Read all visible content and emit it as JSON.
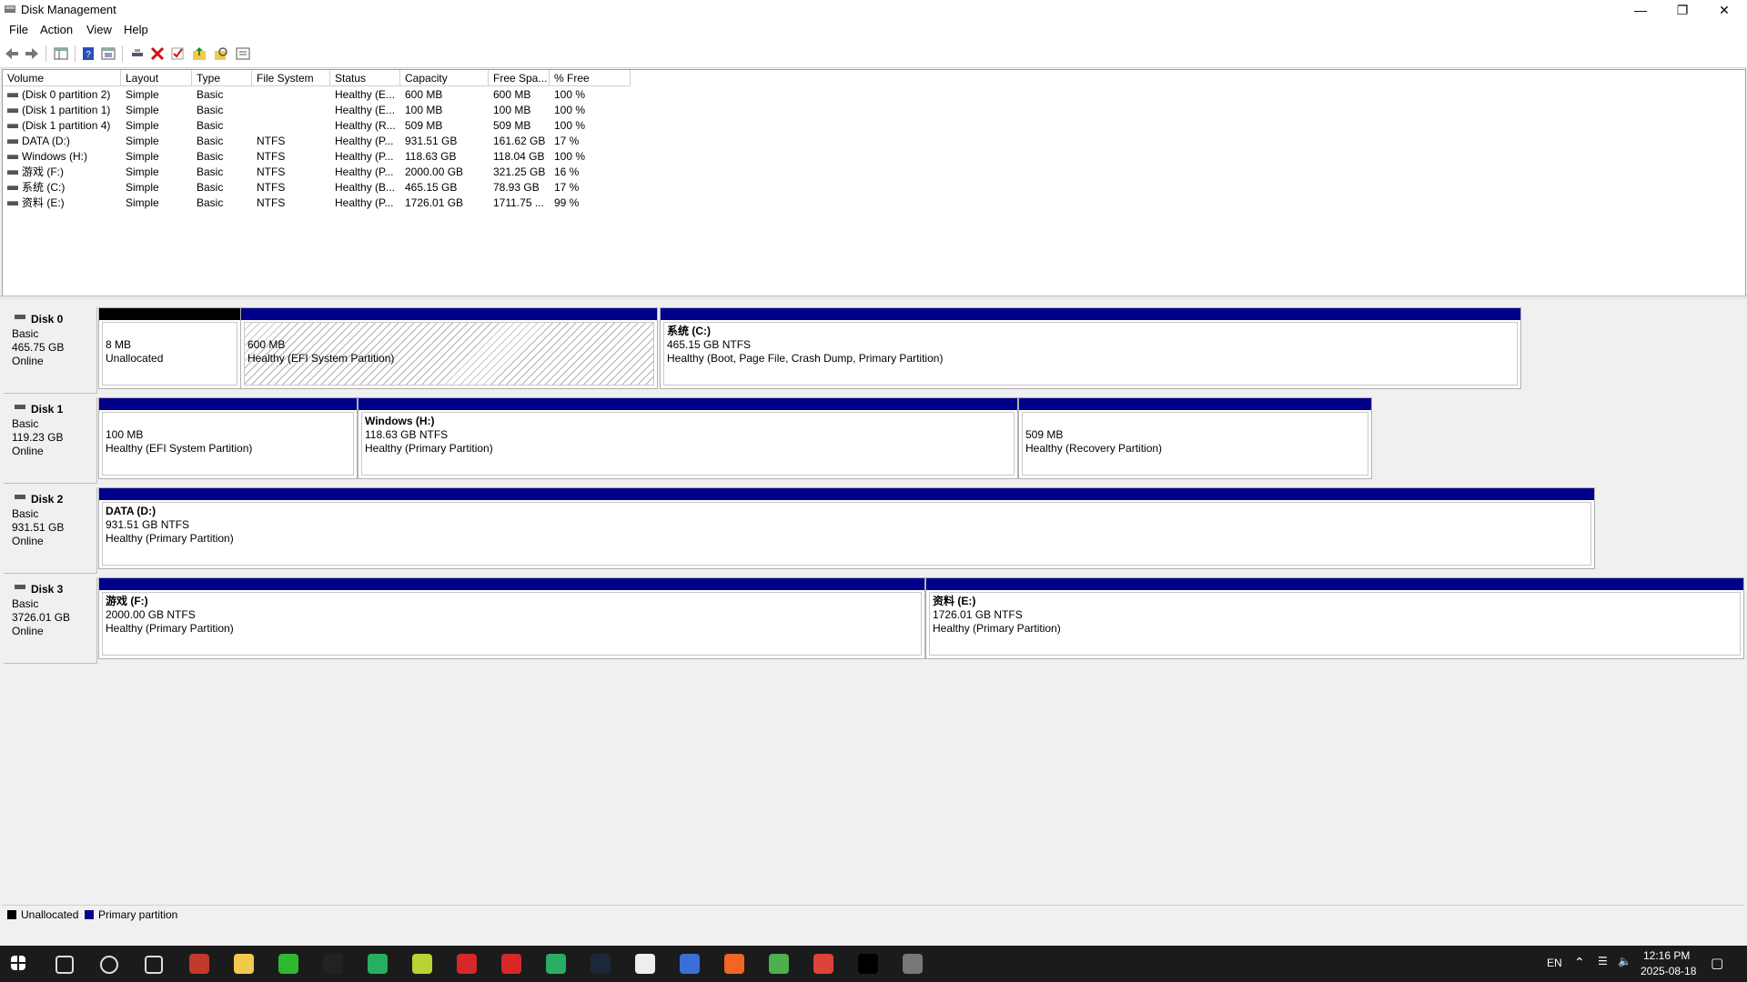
{
  "window": {
    "title": "Disk Management"
  },
  "menu": [
    "File",
    "Action",
    "View",
    "Help"
  ],
  "toolbar": [
    "back-icon",
    "forward-icon",
    "console-tree-icon",
    "help-icon",
    "properties-icon",
    "connect-icon",
    "delete-icon",
    "check-icon",
    "folder-up-icon",
    "search-folder-icon",
    "list-view-icon"
  ],
  "table": {
    "columns": [
      "Volume",
      "Layout",
      "Type",
      "File System",
      "Status",
      "Capacity",
      "Free Spa...",
      "% Free"
    ],
    "rows": [
      [
        "(Disk 0 partition 2)",
        "Simple",
        "Basic",
        "",
        "Healthy (E...",
        "600 MB",
        "600 MB",
        "100 %"
      ],
      [
        "(Disk 1 partition 1)",
        "Simple",
        "Basic",
        "",
        "Healthy (E...",
        "100 MB",
        "100 MB",
        "100 %"
      ],
      [
        "(Disk 1 partition 4)",
        "Simple",
        "Basic",
        "",
        "Healthy (R...",
        "509 MB",
        "509 MB",
        "100 %"
      ],
      [
        "DATA (D:)",
        "Simple",
        "Basic",
        "NTFS",
        "Healthy (P...",
        "931.51 GB",
        "161.62 GB",
        "17 %"
      ],
      [
        "Windows (H:)",
        "Simple",
        "Basic",
        "NTFS",
        "Healthy (P...",
        "118.63 GB",
        "118.04 GB",
        "100 %"
      ],
      [
        "游戏 (F:)",
        "Simple",
        "Basic",
        "NTFS",
        "Healthy (P...",
        "2000.00 GB",
        "321.25 GB",
        "16 %"
      ],
      [
        "系统 (C:)",
        "Simple",
        "Basic",
        "NTFS",
        "Healthy (B...",
        "465.15 GB",
        "78.93 GB",
        "17 %"
      ],
      [
        "资料 (E:)",
        "Simple",
        "Basic",
        "NTFS",
        "Healthy (P...",
        "1726.01 GB",
        "1711.75 ...",
        "99 %"
      ]
    ]
  },
  "disks": [
    {
      "name": "Disk 0",
      "type": "Basic",
      "size": "465.75 GB",
      "status": "Online",
      "partitions": [
        {
          "title": "",
          "line1": "8 MB",
          "line2": "Unallocated",
          "kind": "unallocated"
        },
        {
          "title": "",
          "line1": "600 MB",
          "line2": "Healthy (EFI System Partition)",
          "kind": "hatched"
        },
        {
          "title": "系统  (C:)",
          "line1": "465.15 GB NTFS",
          "line2": "Healthy (Boot, Page File, Crash Dump, Primary Partition)",
          "kind": "primary"
        }
      ]
    },
    {
      "name": "Disk 1",
      "type": "Basic",
      "size": "119.23 GB",
      "status": "Online",
      "partitions": [
        {
          "title": "",
          "line1": "100 MB",
          "line2": "Healthy (EFI System Partition)",
          "kind": "primary"
        },
        {
          "title": "Windows  (H:)",
          "line1": "118.63 GB NTFS",
          "line2": "Healthy (Primary Partition)",
          "kind": "primary"
        },
        {
          "title": "",
          "line1": "509 MB",
          "line2": "Healthy (Recovery Partition)",
          "kind": "primary"
        }
      ]
    },
    {
      "name": "Disk 2",
      "type": "Basic",
      "size": "931.51 GB",
      "status": "Online",
      "partitions": [
        {
          "title": "DATA  (D:)",
          "line1": "931.51 GB NTFS",
          "line2": "Healthy (Primary Partition)",
          "kind": "primary"
        }
      ]
    },
    {
      "name": "Disk 3",
      "type": "Basic",
      "size": "3726.01 GB",
      "status": "Online",
      "partitions": [
        {
          "title": "游戏  (F:)",
          "line1": "2000.00 GB NTFS",
          "line2": "Healthy (Primary Partition)",
          "kind": "primary"
        },
        {
          "title": "资料  (E:)",
          "line1": "1726.01 GB NTFS",
          "line2": "Healthy (Primary Partition)",
          "kind": "primary"
        }
      ]
    }
  ],
  "legend": {
    "unallocated": "Unallocated",
    "primary": "Primary partition"
  },
  "colors": {
    "primary": "#00008b",
    "unallocated": "#000000"
  },
  "taskbar": {
    "apps": [
      "windows-start-icon",
      "search-icon",
      "cortana-icon",
      "task-view-icon",
      "tool-app-icon",
      "file-explorer-icon",
      "wechat-icon",
      "qq-icon",
      "green-app-icon",
      "yellow-app-icon",
      "netease-music-icon",
      "red-app-icon",
      "media-player-icon",
      "steam-icon",
      "document-icon",
      "blue-app-icon",
      "brave-icon",
      "chrome-icon",
      "chrome-profile-icon",
      "terminal-icon",
      "disk-management-icon"
    ],
    "lang": "EN",
    "time": "12:16 PM",
    "date": "2025-08-18"
  }
}
